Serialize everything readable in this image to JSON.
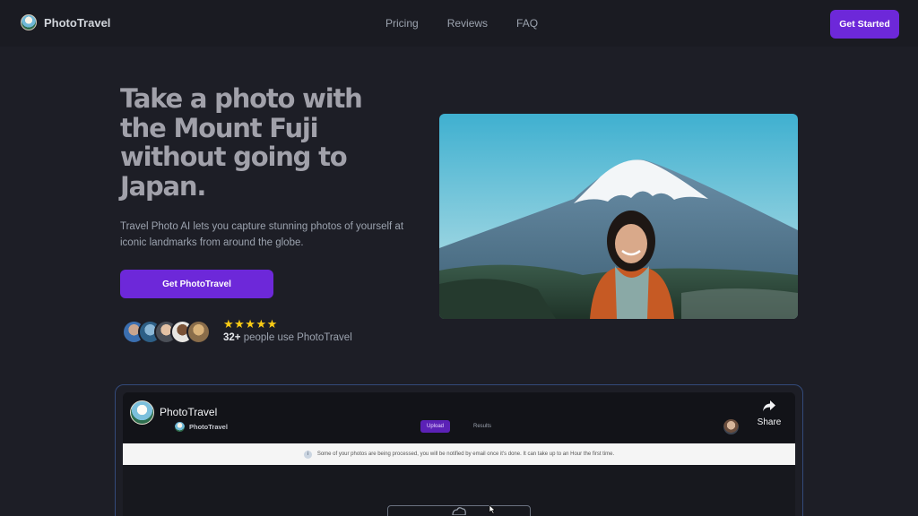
{
  "nav": {
    "brand": "PhotoTravel",
    "links": [
      "Pricing",
      "Reviews",
      "FAQ"
    ],
    "cta": "Get Started"
  },
  "hero": {
    "title": "Take a photo with the Mount Fuji without going to Japan.",
    "description": "Travel Photo AI lets you capture stunning photos of yourself at iconic landmarks from around the globe.",
    "cta": "Get PhotoTravel",
    "stars": "★★★★★",
    "rating": 5,
    "user_count": "32+",
    "user_text": " people use PhotoTravel"
  },
  "hero_image": {
    "icon": "mount-fuji-portrait-photo"
  },
  "video": {
    "channel": "PhotoTravel",
    "share_label": "Share",
    "inner_brand": "PhotoTravel",
    "tabs": [
      "Upload",
      "Results"
    ],
    "notice": "Some of your photos are being processed, you will be notified by email once it's done. It can take up to an Hour the first time."
  },
  "colors": {
    "accent": "#6d28d9",
    "background": "#1d1e26",
    "star": "#facc15"
  }
}
